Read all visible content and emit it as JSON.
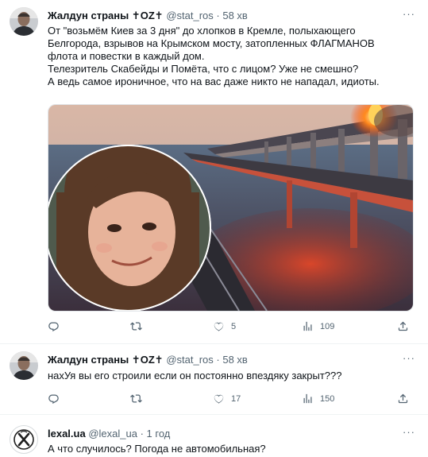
{
  "tweets": [
    {
      "author": "Жалдун страны ✝OZ✝",
      "handle": "@stat_ros",
      "sep": "·",
      "time": "58 хв",
      "lines": [
        "От \"возьмём Киев за 3 дня\" до хлопков в Кремле, полыхающего",
        "Белгорода, взрывов на Крымском мосту, затопленных ФЛАГМАНОВ",
        "флота и повестки в каждый дом.",
        "Телезритель Скабейды и Помёта, что с лицом? Уже не смешно?",
        "А ведь самое ироничное, что на вас даже никто не нападал, идиоты."
      ],
      "reply_count": "",
      "retweet_count": "",
      "like_count": "5",
      "views_count": "109"
    },
    {
      "author": "Жалдун страны ✝OZ✝",
      "handle": "@stat_ros",
      "sep": "·",
      "time": "58 хв",
      "lines": [
        "наxУя вы его строили если он постоянно впездяку закрыт???"
      ],
      "reply_count": "",
      "retweet_count": "",
      "like_count": "17",
      "views_count": "150"
    },
    {
      "author": "lexal.ua",
      "handle": "@lexal_ua",
      "sep": "·",
      "time": "1 год",
      "lines": [
        "А что случилось? Погода не автомобильная?"
      ]
    }
  ],
  "more_label": "···",
  "colors": {
    "text": "#0f1419",
    "muted": "#536471",
    "divider": "#eff3f4"
  },
  "icons": [
    "reply-icon",
    "retweet-icon",
    "like-icon",
    "views-icon",
    "share-icon",
    "more-icon"
  ]
}
